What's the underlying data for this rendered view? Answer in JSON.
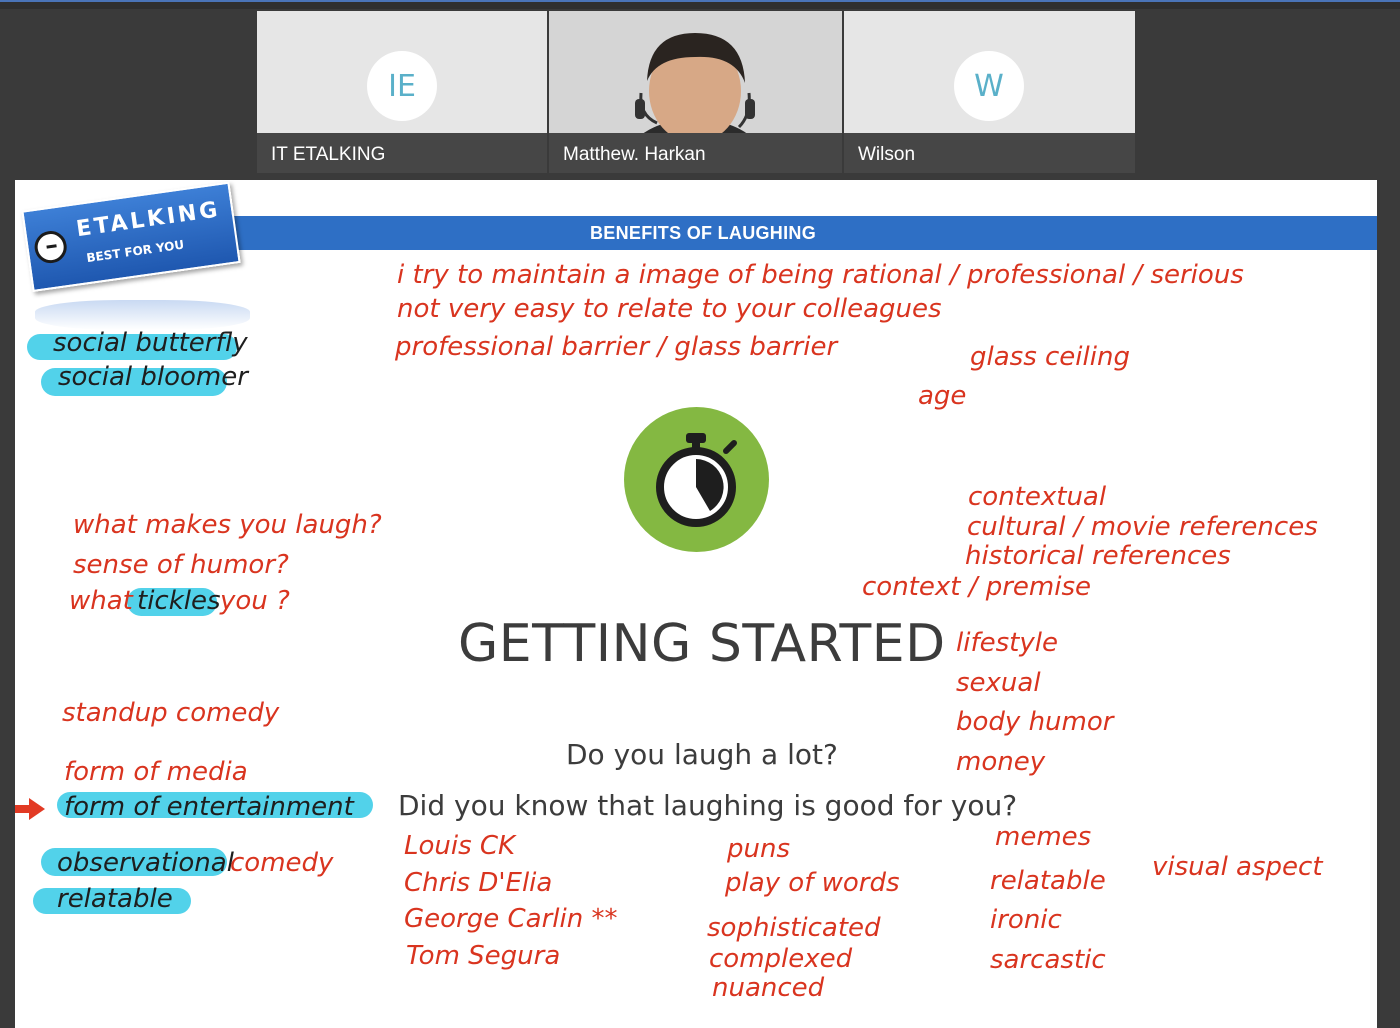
{
  "participants": [
    {
      "initials": "IE",
      "name": "IT ETALKING"
    },
    {
      "initials": "",
      "name": "Matthew. Harkan"
    },
    {
      "initials": "W",
      "name": "Wilson"
    }
  ],
  "slide": {
    "logo": {
      "main": "ETALKING",
      "sub": "BEST FOR YOU"
    },
    "banner": "BENEFITS OF LAUGHING",
    "title": "GETTING STARTED",
    "question1": "Do you laugh a lot?",
    "question2": "Did you know that laughing is good for you?",
    "timer_icon": "stopwatch-icon"
  },
  "annotations": {
    "rational": "i try to maintain a image of being rational / professional / serious",
    "relate": "not very easy to relate to your colleagues",
    "barrier": "professional barrier / glass barrier",
    "glass_ceiling": "glass ceiling",
    "age": "age",
    "social_butterfly": "social butterfly",
    "social_bloomer": "social bloomer",
    "what_makes": "what makes you laugh?",
    "sense_humor": "sense of humor?",
    "what": "what",
    "tickles": "tickles",
    "you": "you ?",
    "contextual": "contextual",
    "cultural": "cultural / movie references",
    "historical": "historical references",
    "context_premise": "context / premise",
    "lifestyle": "lifestyle",
    "sexual": "sexual",
    "body_humor": "body humor",
    "money": "money",
    "standup": "standup comedy",
    "form_media": "form of media",
    "form_entertainment": "form of entertainment",
    "observational": "observational",
    "comedy": "comedy",
    "relatable_left": "relatable",
    "louis": "Louis CK",
    "chris": "Chris D'Elia",
    "george": "George Carlin **",
    "tom": "Tom Segura",
    "puns": "puns",
    "play_words": "play of words",
    "sophisticated": "sophisticated",
    "complexed": "complexed",
    "nuanced": "nuanced",
    "memes": "memes",
    "relatable_right": "relatable",
    "ironic": "ironic",
    "sarcastic": "sarcastic",
    "visual": "visual aspect"
  },
  "colors": {
    "banner": "#2e6fc5",
    "ink": "#d9341f",
    "highlight": "#52d2ea",
    "timer": "#84b842"
  }
}
